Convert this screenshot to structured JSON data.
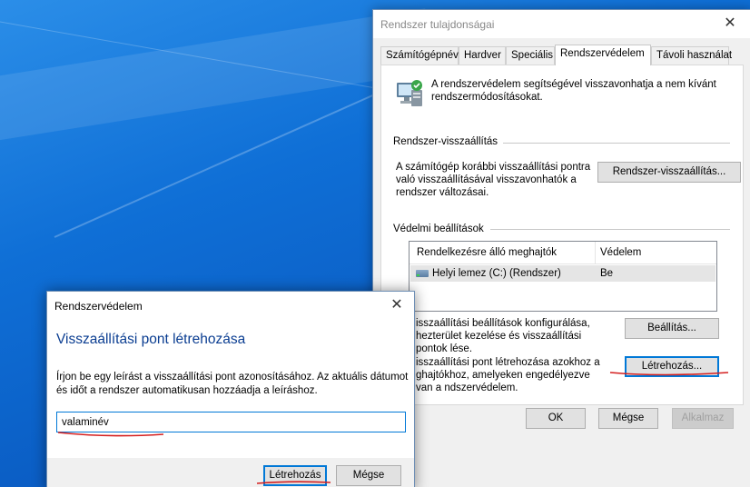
{
  "main_window": {
    "title": "Rendszer tulajdonságai",
    "close_glyph": "✕",
    "tabs": [
      {
        "label": "Számítógépnév",
        "active": false
      },
      {
        "label": "Hardver",
        "active": false
      },
      {
        "label": "Speciális",
        "active": false
      },
      {
        "label": "Rendszervédelem",
        "active": true
      },
      {
        "label": "Távoli használat",
        "active": false
      }
    ],
    "intro_text": "A rendszervédelem segítségével visszavonhatja a nem kívánt rendszermódosításokat.",
    "restore_group": {
      "title": "Rendszer-visszaállítás",
      "description": "A számítógép korábbi visszaállítási pontra való visszaállításával visszavonhatók a rendszer változásai.",
      "button": "Rendszer-visszaállítás..."
    },
    "protection_group": {
      "title": "Védelmi beállítások",
      "columns": [
        "Rendelkezésre álló meghajtók",
        "Védelem"
      ],
      "rows": [
        {
          "drive": "Helyi lemez (C:) (Rendszer)",
          "protection": "Be"
        }
      ],
      "configure_text": "isszaállítási beállítások konfigurálása, hezterület kezelése és visszaállítási pontok lése.",
      "configure_button": "Beállítás...",
      "create_text": "isszaállítási pont létrehozása azokhoz a ghajtókhoz, amelyeken engedélyezve van a ndszervédelem.",
      "create_button": "Létrehozás..."
    },
    "footer": {
      "ok": "OK",
      "cancel": "Mégse",
      "apply": "Alkalmaz"
    }
  },
  "dialog": {
    "title": "Rendszervédelem",
    "close_glyph": "✕",
    "heading": "Visszaállítási pont létrehozása",
    "description": "Írjon be egy leírást a visszaállítási pont azonosításához. Az aktuális dátumot és időt a rendszer automatikusan hozzáadja a leíráshoz.",
    "input_value": "valaminév",
    "create_button": "Létrehozás",
    "cancel_button": "Mégse"
  },
  "colors": {
    "desktop": "#0f6fd6",
    "heading": "#0a3d91",
    "focus": "#0078d7",
    "annotation": "#d42020"
  }
}
